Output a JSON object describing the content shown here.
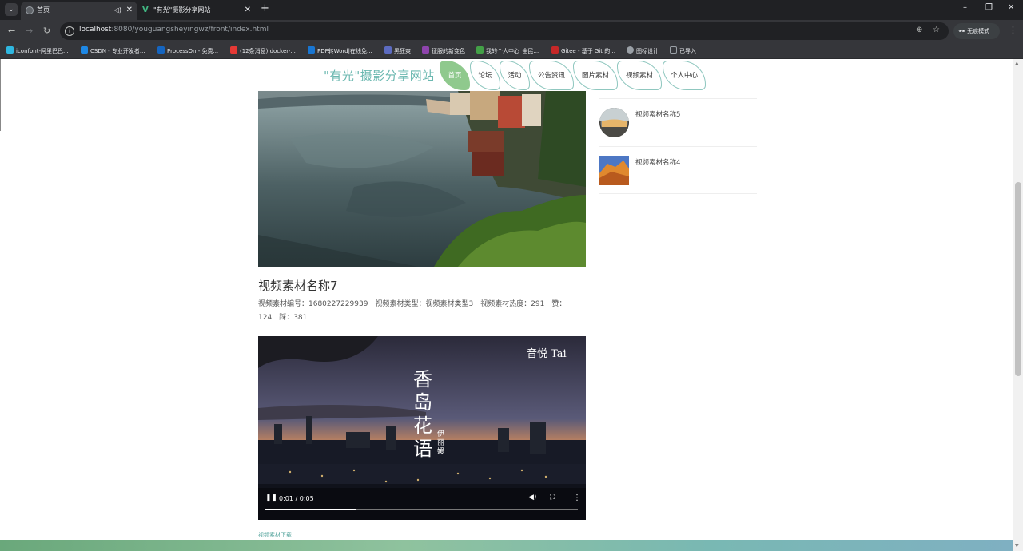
{
  "browser": {
    "tabs": [
      {
        "title": "首页",
        "active": true
      },
      {
        "title": "\"有光\"摄影分享网站",
        "active": false
      }
    ],
    "new_tab": "+",
    "window_controls": [
      "–",
      "❐",
      "✕"
    ],
    "url_host": "localhost",
    "url_rest": ":8080/youguangsheyingwz/front/index.html",
    "incognito_label": "无痕模式",
    "bookmarks": [
      {
        "label": "iconfont-阿里巴巴...",
        "color": "#2fb7e0"
      },
      {
        "label": "CSDN - 专业开发者...",
        "color": "#1e88e5"
      },
      {
        "label": "ProcessOn - 免费...",
        "color": "#1565c0"
      },
      {
        "label": "(12条消息) docker-...",
        "color": "#e53935"
      },
      {
        "label": "PDF转Word|在线免...",
        "color": "#1976d2"
      },
      {
        "label": "黑狂爽",
        "color": "#5c6bc0"
      },
      {
        "label": "征服的新变色",
        "color": "#8e44ad"
      },
      {
        "label": "我的个人中心_全民...",
        "color": "#43a047"
      },
      {
        "label": "Gitee - 基于 Git 的...",
        "color": "#c62828"
      },
      {
        "label": "图标设计",
        "color": "#9aa0a6"
      },
      {
        "label": "已导入",
        "color": "#9aa0a6"
      }
    ]
  },
  "site": {
    "title": "\"有光\"摄影分享网站",
    "nav": [
      {
        "label": "首页",
        "active": true
      },
      {
        "label": "论坛",
        "active": false
      },
      {
        "label": "活动",
        "active": false
      },
      {
        "label": "公告资讯",
        "active": false
      },
      {
        "label": "图片素材",
        "active": false
      },
      {
        "label": "视频素材",
        "active": false
      },
      {
        "label": "个人中心",
        "active": false
      }
    ],
    "accent": "#6bb8b0",
    "nav_active_color": "#8fc98d"
  },
  "detail": {
    "title": "视频素材名称7",
    "meta": [
      "视频素材编号：1680227229939",
      "视频素材类型：视频素材类型3",
      "视频素材热度：291",
      "赞：124",
      "踩：381"
    ],
    "video": {
      "time": "0:01 / 0:05",
      "progress": 0.29,
      "watermark": "音悦 Tai",
      "overlay_text": "香岛花语",
      "overlay_sub": "伊丽媛"
    },
    "download_label": "视频素材下载"
  },
  "sidebar": {
    "items": [
      {
        "label": "视频素材名称5"
      },
      {
        "label": "视频素材名称4"
      }
    ]
  }
}
